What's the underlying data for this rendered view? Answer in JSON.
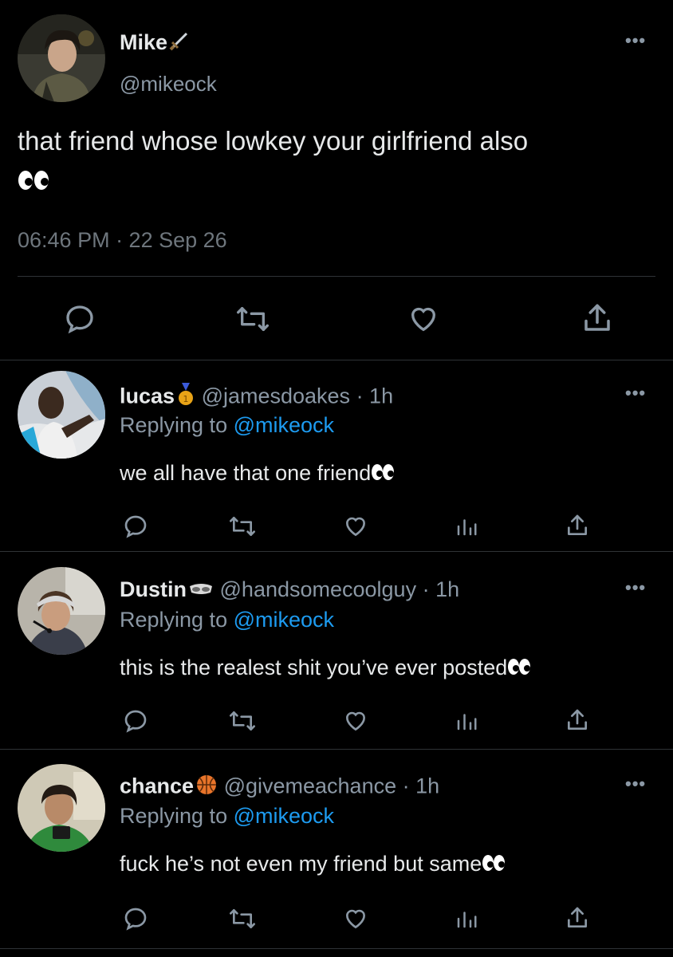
{
  "main_tweet": {
    "name": "Mike",
    "name_emoji": "dagger-icon",
    "handle": "@mikeock",
    "text": "that friend whose lowkey your girlfriend also",
    "text_emoji": "eyes-emoji",
    "timestamp": "06:46 PM · 22 Sep 26",
    "actions": [
      "reply-icon",
      "retweet-icon",
      "like-icon",
      "share-icon"
    ]
  },
  "replies": [
    {
      "name": "lucas",
      "name_emoji": "gold-medal-emoji",
      "handle": "@jamesdoakes",
      "meta": " · 1h",
      "replying_prefix": "Replying to ",
      "replying_to": "@mikeock",
      "text": "we all have that one friend",
      "text_emoji": "eyes-emoji"
    },
    {
      "name": "Dustin",
      "name_emoji": "goggles-emoji",
      "handle": "@handsomecoolguy",
      "meta": " · 1h",
      "replying_prefix": "Replying to ",
      "replying_to": "@mikeock",
      "text": "this is the realest shit you’ve ever posted",
      "text_emoji": "eyes-emoji"
    },
    {
      "name": "chance",
      "name_emoji": "basketball-emoji",
      "handle": "@givemeachance",
      "meta": " · 1h",
      "replying_prefix": "Replying to ",
      "replying_to": "@mikeock",
      "text": "fuck he’s not even my friend but same",
      "text_emoji": "eyes-emoji"
    }
  ],
  "colors": {
    "background": "#000000",
    "primary_text": "#e7e9ea",
    "secondary_text": "#8b98a5",
    "link": "#1d9bf0",
    "divider": "#2f3336"
  }
}
